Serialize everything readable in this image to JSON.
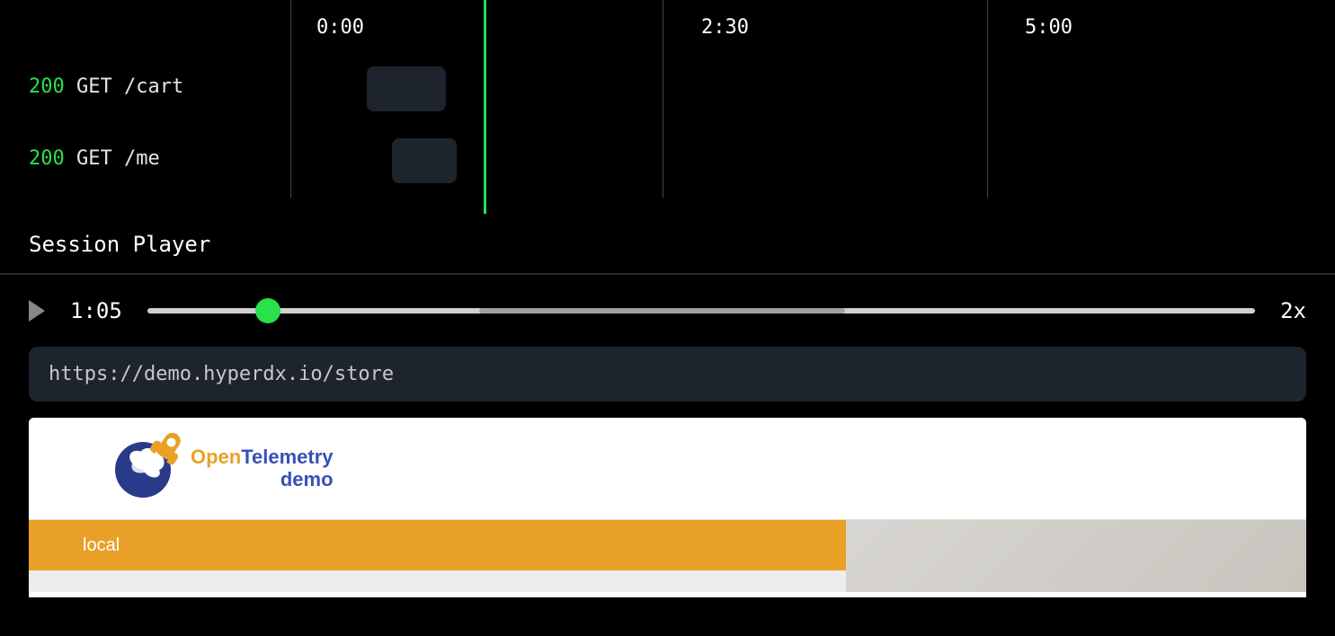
{
  "timeline": {
    "ticks": [
      "0:00",
      "2:30",
      "5:00"
    ],
    "traces": [
      {
        "status": "200",
        "method": "GET",
        "path": "/cart"
      },
      {
        "status": "200",
        "method": "GET",
        "path": "/me"
      }
    ]
  },
  "section_title": "Session Player",
  "player": {
    "current_time": "1:05",
    "speed": "2x",
    "url": "https://demo.hyperdx.io/store"
  },
  "replay": {
    "logo_open": "Open",
    "logo_telemetry": "Telemetry",
    "logo_demo": "demo",
    "local_tag": "local"
  }
}
